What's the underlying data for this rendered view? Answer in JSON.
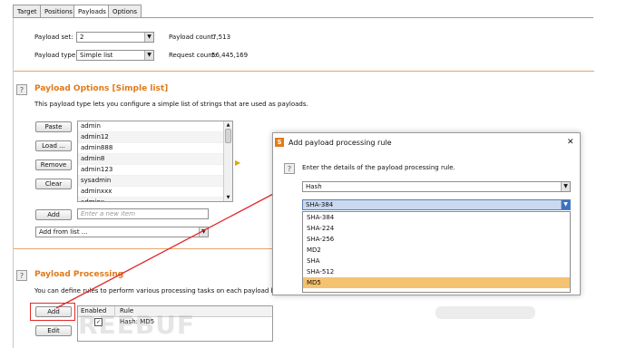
{
  "tabs": [
    "Target",
    "Positions",
    "Payloads",
    "Options"
  ],
  "payload_set": {
    "label": "Payload set:",
    "value": "2",
    "count_label": "Payload count:",
    "count_value": "7,513"
  },
  "payload_type": {
    "label": "Payload type:",
    "value": "Simple list",
    "request_label": "Request count:",
    "request_value": "56,445,169"
  },
  "options": {
    "title": "Payload Options [Simple list]",
    "description": "This payload type lets you configure a simple list of strings that are used as payloads.",
    "buttons": [
      "Paste",
      "Load ...",
      "Remove",
      "Clear"
    ],
    "items": [
      "admin",
      "admin12",
      "admin888",
      "admin8",
      "admin123",
      "sysadmin",
      "adminxxx",
      "adminx"
    ],
    "add_label": "Add",
    "add_placeholder": "Enter a new item",
    "add_from_list": "Add from list ..."
  },
  "processing": {
    "title": "Payload Processing",
    "description": "You can define rules to perform various processing tasks on each payload before it is",
    "add_label": "Add",
    "edit_label": "Edit",
    "col_enabled": "Enabled",
    "col_rule": "Rule",
    "rule": "Hash: MD5"
  },
  "dialog": {
    "title": "Add payload processing rule",
    "close": "✕",
    "instruction": "Enter the details of the payload processing rule.",
    "type_value": "Hash",
    "algo_value": "SHA-384",
    "options": [
      "SHA-384",
      "SHA-224",
      "SHA-256",
      "MD2",
      "SHA",
      "SHA-512",
      "MD5"
    ],
    "selected_index": 6
  },
  "watermark": "REEBUF",
  "colors": {
    "accent": "#e07a1b",
    "arrow": "#e0282a",
    "selected": "#f5c270"
  }
}
